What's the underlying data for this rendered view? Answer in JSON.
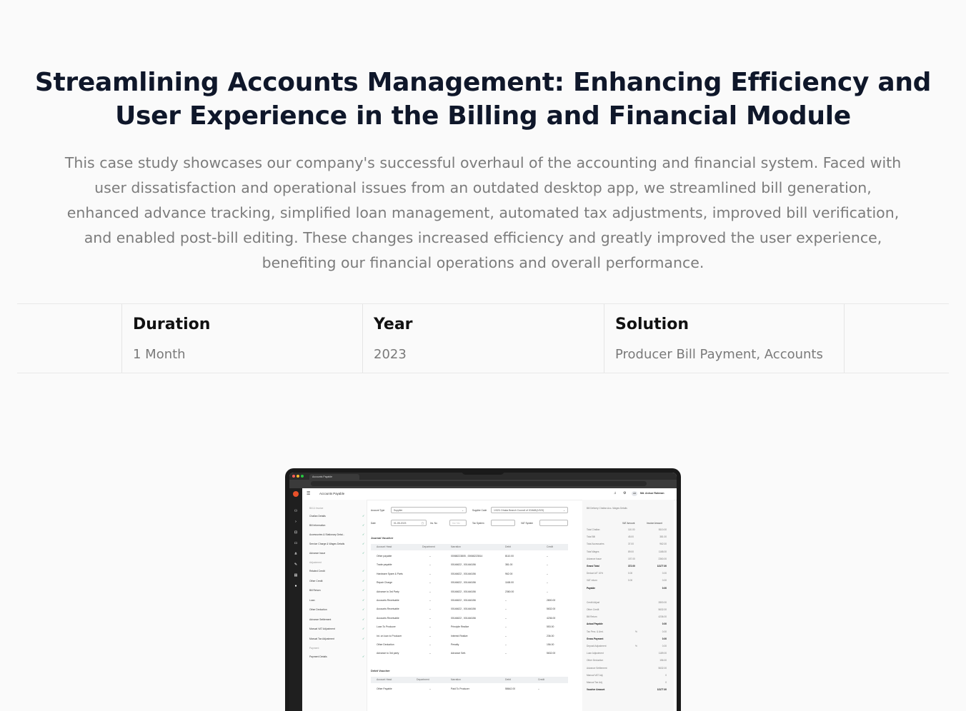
{
  "hero": {
    "title": "Streamlining Accounts Management: Enhancing Efficiency and User Experience in the Billing and Financial Module",
    "description": "This case study showcases our company's successful overhaul of the accounting and financial system. Faced with user dissatisfaction and operational issues from an outdated desktop app, we streamlined bill generation, enhanced advance tracking, simplified loan management, automated tax adjustments, improved bill verification, and enabled post-bill editing. These changes increased efficiency and greatly improved the user experience, benefiting our financial operations and overall performance."
  },
  "meta": [
    {
      "label": "Duration",
      "value": "1 Month"
    },
    {
      "label": "Year",
      "value": "2023"
    },
    {
      "label": "Solution",
      "value": "Producer Bill Payment, Accounts"
    }
  ],
  "mockup": {
    "browser_tab": "Accounts Payable",
    "app_title": "Accounts Payable",
    "user_initials": "AR",
    "user_name": "Md. Anisur Rahman",
    "menu": {
      "section_bill": "Bill & Invoice",
      "items_bill": [
        "Challan Details",
        "Bill Information",
        "Accessories & Stationary Detai...",
        "Service Charge & Wages Details",
        "Advance Issue"
      ],
      "section_adjust": "Adjustment",
      "items_adjust": [
        "Related Credit",
        "Other Credit",
        "Bill Return",
        "Loan",
        "Other Deduction",
        "Advance Settlement",
        "Manual VAT Adjustment",
        "Manual Tax Adjustment"
      ],
      "section_payment": "Payment",
      "items_payment": [
        "Payment Details"
      ]
    },
    "form": {
      "account_type_label": "Account Type",
      "account_type_value": "Supplier",
      "supplier_code_label": "Supplier Code",
      "supplier_code_value": "1/023: Dhaka Branch Council of ICMAB(1/023)",
      "date_label": "Date",
      "date_value": "01-05-2023",
      "inv_no_label": "Inv. No",
      "inv_no_placeholder": "Inv. No",
      "tax_system_label": "Tax System",
      "vat_system_label": "VAT System"
    },
    "journal": {
      "title": "Journal Voucher",
      "headers": [
        "Account Head",
        "Department",
        "Narration",
        "Debit",
        "Credit"
      ],
      "rows": [
        [
          "Other payable",
          "–",
          "00068223805 , 00068223514",
          "8110.00",
          "–"
        ],
        [
          "Trade payable",
          "–",
          "00146622 , 001446156",
          "381.00",
          "–"
        ],
        [
          "Hardware Spare & Parts",
          "–",
          "00146622 , 001446156",
          "962.00",
          "–"
        ],
        [
          "Repair Charge",
          "–",
          "00146622 , 001446156",
          "1168.00",
          "–"
        ],
        [
          "Advance to 3rd Party",
          "–",
          "00146622 , 001446156",
          "2360.00",
          "–"
        ],
        [
          "Accounts Receivable",
          "–",
          "00146622 , 001446156",
          "–",
          "2800.00"
        ],
        [
          "Accounts Receivable",
          "–",
          "00146622 , 001446156",
          "–",
          "5632.00"
        ],
        [
          "Accounts Receivable",
          "–",
          "00146622 , 001446156",
          "–",
          "4236.00"
        ],
        [
          "Loan To Producer",
          "–",
          "Principle Realize",
          "–",
          "553.00"
        ],
        [
          "Int. on loan to Producer",
          "–",
          "Interest Realize",
          "–",
          "236.00"
        ],
        [
          "Other Deduction",
          "–",
          "Penalty",
          "–",
          "156.00"
        ],
        [
          "Advance to 3rd party",
          "–",
          "Advance Sett.",
          "–",
          "5632.00"
        ]
      ]
    },
    "debit": {
      "title": "Debit Voucher",
      "headers": [
        "Account Head",
        "Department",
        "Narration",
        "Debit",
        "Credit"
      ],
      "rows": [
        [
          "Other Payable",
          "–",
          "Paid To Producer",
          "58642.00",
          "–"
        ]
      ]
    },
    "summary": {
      "title": "Bill Delivery Challan Acc.-Wages Details",
      "col_vat": "VAT Amount",
      "col_invoice": "Invoice Amount",
      "rows": [
        [
          "Total Challan",
          "110.00",
          "8110.00"
        ],
        [
          "Total Bill",
          "45.00",
          "381.00"
        ],
        [
          "Total Accessories",
          "37.00",
          "962.00"
        ],
        [
          "Total Wages",
          "89.00",
          "1168.00"
        ],
        [
          "Advance Issue",
          "157.00",
          "2360.00"
        ]
      ],
      "grand_total_label": "Grand Total",
      "grand_total_vat": "372.00",
      "grand_total_inv": "13177.00",
      "rows2": [
        [
          "Deduct AIT 10%",
          "0.00",
          "0.00"
        ],
        [
          "VAT return",
          "0.00",
          "0.00"
        ]
      ],
      "payable_label": "Payable",
      "payable_value": "0.00",
      "rows3": [
        [
          "Credit Adjust",
          "2800.00"
        ],
        [
          "Other Credit",
          "5632.00"
        ],
        [
          "Bill Return",
          "4236.00"
        ]
      ],
      "actual_payable_label": "Actual Payable",
      "actual_payable_value": "0.00",
      "tax_label": "Tax Perc. & Amt.",
      "tax_pct": "%",
      "tax_value": "0.00",
      "gross_label": "Gross Payment",
      "gross_value": "0.00",
      "deposit_label": "Deposit Adjustment",
      "deposit_pct": "%",
      "deposit_value": "0.00",
      "rows4": [
        [
          "Loan Adjustment",
          "1189.00"
        ],
        [
          "Other Deduction",
          "156.00"
        ],
        [
          "Advance Settlement",
          "5632.00"
        ],
        [
          "Manual VAT Adj.",
          "0"
        ],
        [
          "Manual Tax Adj.",
          "0"
        ]
      ],
      "voucher_label": "Voucher Amount",
      "voucher_value": "13177.00"
    }
  }
}
